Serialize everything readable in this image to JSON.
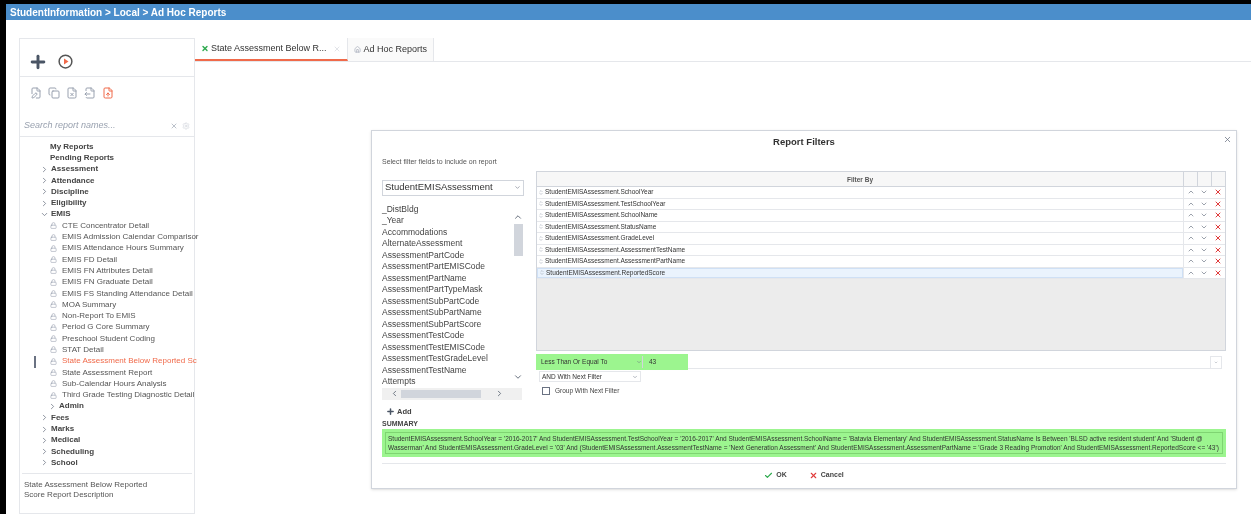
{
  "breadcrumb": "StudentInformation > Local > Ad Hoc Reports",
  "sidebar": {
    "search": {
      "placeholder": "Search report names..."
    },
    "items": [
      {
        "kind": "plain",
        "label": "My Reports",
        "selected": false
      },
      {
        "kind": "plain",
        "label": "Pending Reports",
        "selected": false
      },
      {
        "kind": "folder",
        "label": "Assessment",
        "expanded": false,
        "selected": false
      },
      {
        "kind": "folder",
        "label": "Attendance",
        "expanded": false,
        "selected": false
      },
      {
        "kind": "folder",
        "label": "Discipline",
        "expanded": false,
        "selected": false
      },
      {
        "kind": "folder",
        "label": "Eligibility",
        "expanded": false,
        "selected": false
      },
      {
        "kind": "folder",
        "label": "EMIS",
        "expanded": true,
        "selected": false,
        "children": [
          {
            "kind": "report",
            "label": "CTE Concentrator Detail",
            "selected": false
          },
          {
            "kind": "report",
            "label": "EMIS Admission Calendar Comparisor",
            "selected": false
          },
          {
            "kind": "report",
            "label": "EMIS Attendance Hours Summary",
            "selected": false
          },
          {
            "kind": "report",
            "label": "EMIS FD Detail",
            "selected": false
          },
          {
            "kind": "report",
            "label": "EMIS FN Attributes Detail",
            "selected": false
          },
          {
            "kind": "report",
            "label": "EMIS FN Graduate Detail",
            "selected": false
          },
          {
            "kind": "report",
            "label": "EMIS FS Standing Attendance Detail",
            "selected": false
          },
          {
            "kind": "report",
            "label": "MOA Summary",
            "selected": false
          },
          {
            "kind": "report",
            "label": "Non-Report To EMIS",
            "selected": false
          },
          {
            "kind": "report",
            "label": "Period G Core Summary",
            "selected": false
          },
          {
            "kind": "report",
            "label": "Preschool Student Coding",
            "selected": false
          },
          {
            "kind": "report",
            "label": "STAT Detail",
            "selected": false
          },
          {
            "kind": "report",
            "label": "State Assessment Below Reported Sc",
            "selected": true
          },
          {
            "kind": "report",
            "label": "State Assessment Report",
            "selected": false
          },
          {
            "kind": "report",
            "label": "Sub-Calendar Hours Analysis",
            "selected": false
          },
          {
            "kind": "report",
            "label": "Third Grade Testing Diagnostic Detail",
            "selected": false
          },
          {
            "kind": "folder",
            "label": "Admin",
            "expanded": false,
            "selected": false
          }
        ]
      },
      {
        "kind": "folder",
        "label": "Fees",
        "expanded": false,
        "selected": false
      },
      {
        "kind": "folder",
        "label": "Marks",
        "expanded": false,
        "selected": false
      },
      {
        "kind": "folder",
        "label": "Medical",
        "expanded": false,
        "selected": false
      },
      {
        "kind": "folder",
        "label": "Scheduling",
        "expanded": false,
        "selected": false
      },
      {
        "kind": "folder",
        "label": "School",
        "expanded": false,
        "selected": false
      }
    ],
    "description": "State Assessment Below Reported Score Report Description"
  },
  "tabs": [
    {
      "kind": "report",
      "label": "State Assessment Below R...",
      "selected": true,
      "closable": true
    },
    {
      "kind": "home",
      "label": "Ad Hoc Reports",
      "selected": false,
      "closable": false
    }
  ],
  "dialog": {
    "title": "Report Filters",
    "instruction": "Select filter fields to include on report",
    "table_select": "StudentEMISAssessment",
    "fields": [
      "_DistBldg",
      "_Year",
      "Accommodations",
      "AlternateAssessment",
      "AssessmentPartCode",
      "AssessmentPartEMISCode",
      "AssessmentPartName",
      "AssessmentPartTypeMask",
      "AssessmentSubPartCode",
      "AssessmentSubPartName",
      "AssessmentSubPartScore",
      "AssessmentTestCode",
      "AssessmentTestEMISCode",
      "AssessmentTestGradeLevel",
      "AssessmentTestName",
      "Attempts"
    ],
    "add_button": "Add",
    "filter_header": "Filter By",
    "filters": [
      {
        "field": "StudentEMISAssessment.SchoolYear",
        "selected": false
      },
      {
        "field": "StudentEMISAssessment.TestSchoolYear",
        "selected": false
      },
      {
        "field": "StudentEMISAssessment.SchoolName",
        "selected": false
      },
      {
        "field": "StudentEMISAssessment.StatusName",
        "selected": false
      },
      {
        "field": "StudentEMISAssessment.GradeLevel",
        "selected": false
      },
      {
        "field": "StudentEMISAssessment.AssessmentTestName",
        "selected": false
      },
      {
        "field": "StudentEMISAssessment.AssessmentPartName",
        "selected": false
      },
      {
        "field": "StudentEMISAssessment.ReportedScore",
        "selected": true
      }
    ],
    "operator": "Less Than Or Equal To",
    "value": "43",
    "connector": "AND With Next Filter",
    "group_with_next": {
      "label": "Group With Next Filter",
      "checked": false
    },
    "summary_label": "SUMMARY",
    "summary": "StudentEMISAssessment.SchoolYear = '2016-2017' And StudentEMISAssessment.TestSchoolYear = '2016-2017' And StudentEMISAssessment.SchoolName = 'Batavia Elementary' And StudentEMISAssessment.StatusName Is Between 'BLSD active resident student' And 'Student @ Wasserman' And StudentEMISAssessment.GradeLevel = '03' And (StudentEMISAssessment.AssessmentTestName = 'Next Generation Assessment' And StudentEMISAssessment.AssessmentPartName = 'Grade 3 Reading Promotion' And StudentEMISAssessment.ReportedScore <= '43')",
    "buttons": [
      {
        "kind": "ok",
        "label": "OK"
      },
      {
        "kind": "cancel",
        "label": "Cancel"
      }
    ]
  }
}
